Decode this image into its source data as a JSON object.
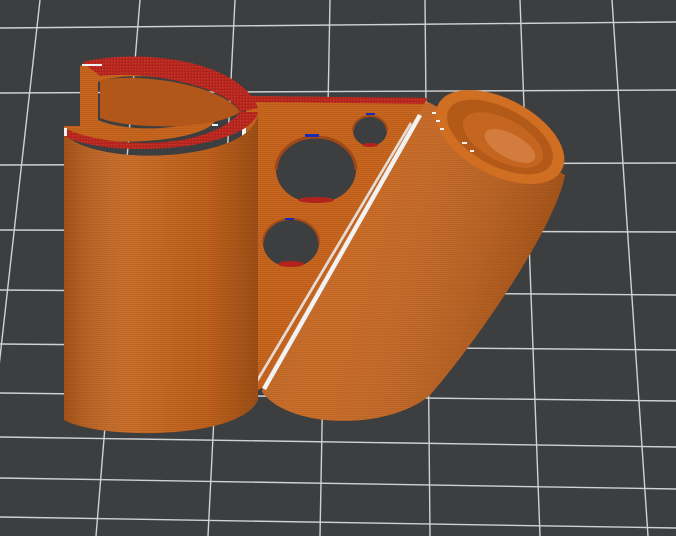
{
  "viewport": {
    "background_color": "#3d3e3f",
    "grid_line_color": "#cfd2d4",
    "view_mode": "3d-slicer-preview"
  },
  "model": {
    "filament_color": "#c8661d",
    "filament_shadow_color": "#a65215",
    "filament_highlight_color": "#df7a2c",
    "top_layer_color": "#b2231d",
    "travel_mark_color": "#f2f2f2",
    "seam_mark_color": "#1a2ab8",
    "parts": [
      "open-cylinder",
      "triangular-plate-with-holes",
      "angled-tube"
    ]
  }
}
